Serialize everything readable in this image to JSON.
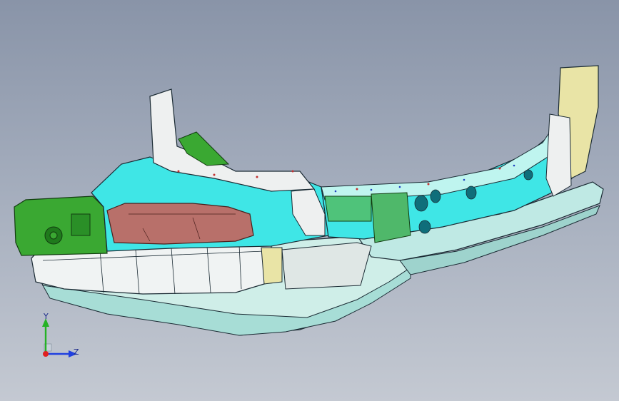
{
  "viewport": {
    "background_top": "#8994a8",
    "background_bottom": "#c4c9d2"
  },
  "model": {
    "description_icon": "car-body-side-frame-assembly",
    "colors": {
      "cyan": "#3fe6e6",
      "light_cyan": "#bff5ef",
      "green": "#3aa832",
      "dark_green": "#1f7a1c",
      "rose": "#b8706a",
      "white_grey": "#e8ecec",
      "pale_yellow": "#e9e4a6",
      "edge": "#1a2a33"
    }
  },
  "triad": {
    "y_label": "Y",
    "z_label": "Z",
    "x_color": "#e02020",
    "y_color": "#25b225",
    "z_color": "#2040e0"
  }
}
